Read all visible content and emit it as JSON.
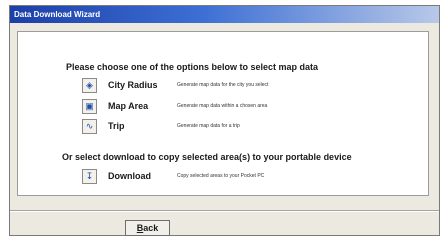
{
  "window": {
    "title": "Data Download Wizard"
  },
  "heading": "Please choose one of the options below to select map data",
  "options": [
    {
      "label": "City Radius",
      "description": "Generate map data for the city you select",
      "icon": "city-radius-icon"
    },
    {
      "label": "Map Area",
      "description": "Generate map data within a chosen area",
      "icon": "map-area-icon"
    },
    {
      "label": "Trip",
      "description": "Generate map data for a trip",
      "icon": "trip-icon"
    }
  ],
  "heading2": "Or select download to copy selected area(s) to your portable device",
  "download": {
    "label": "Download",
    "description": "Copy selected areas to your Pocket PC",
    "icon": "download-icon"
  },
  "buttons": {
    "back_first": "B",
    "back_rest": "ack"
  }
}
